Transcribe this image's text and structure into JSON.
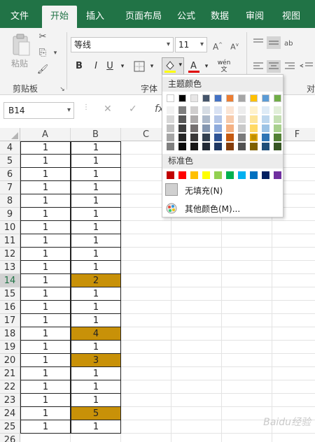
{
  "tabs": [
    {
      "label": "文件",
      "active": false
    },
    {
      "label": "开始",
      "active": true
    },
    {
      "label": "插入",
      "active": false
    },
    {
      "label": "页面布局",
      "active": false
    },
    {
      "label": "公式",
      "active": false
    },
    {
      "label": "数据",
      "active": false
    },
    {
      "label": "审阅",
      "active": false
    },
    {
      "label": "视图",
      "active": false
    }
  ],
  "ribbon": {
    "paste_label": "粘贴",
    "clipboard_group": "剪贴板",
    "font_group": "字体",
    "right_group_partial": "对",
    "font_name": "等线",
    "font_size": "11",
    "bold": "B",
    "italic": "I",
    "underline": "U",
    "phonetic": "wén"
  },
  "formula_bar": {
    "name_box": "B14",
    "fx": "fx"
  },
  "grid": {
    "columns": [
      "A",
      "B",
      "C",
      "F"
    ],
    "rows": [
      {
        "n": "4",
        "a": "1",
        "b": "1",
        "highlight": false
      },
      {
        "n": "5",
        "a": "1",
        "b": "1",
        "highlight": false
      },
      {
        "n": "6",
        "a": "1",
        "b": "1",
        "highlight": false
      },
      {
        "n": "7",
        "a": "1",
        "b": "1",
        "highlight": false
      },
      {
        "n": "8",
        "a": "1",
        "b": "1",
        "highlight": false
      },
      {
        "n": "9",
        "a": "1",
        "b": "1",
        "highlight": false
      },
      {
        "n": "10",
        "a": "1",
        "b": "1",
        "highlight": false
      },
      {
        "n": "11",
        "a": "1",
        "b": "1",
        "highlight": false
      },
      {
        "n": "12",
        "a": "1",
        "b": "1",
        "highlight": false
      },
      {
        "n": "13",
        "a": "1",
        "b": "1",
        "highlight": false
      },
      {
        "n": "14",
        "a": "1",
        "b": "2",
        "highlight": true
      },
      {
        "n": "15",
        "a": "1",
        "b": "1",
        "highlight": false
      },
      {
        "n": "16",
        "a": "1",
        "b": "1",
        "highlight": false
      },
      {
        "n": "17",
        "a": "1",
        "b": "1",
        "highlight": false
      },
      {
        "n": "18",
        "a": "1",
        "b": "4",
        "highlight": true
      },
      {
        "n": "19",
        "a": "1",
        "b": "1",
        "highlight": false
      },
      {
        "n": "20",
        "a": "1",
        "b": "3",
        "highlight": true
      },
      {
        "n": "21",
        "a": "1",
        "b": "1",
        "highlight": false
      },
      {
        "n": "22",
        "a": "1",
        "b": "1",
        "highlight": false
      },
      {
        "n": "23",
        "a": "1",
        "b": "1",
        "highlight": false
      },
      {
        "n": "24",
        "a": "1",
        "b": "5",
        "highlight": true
      },
      {
        "n": "25",
        "a": "1",
        "b": "1",
        "highlight": false
      },
      {
        "n": "26",
        "a": "",
        "b": "",
        "highlight": false
      }
    ],
    "highlight_color": "#C89108",
    "selected_row": "14"
  },
  "color_menu": {
    "theme_header": "主题颜色",
    "standard_header": "标准色",
    "no_fill": "无填充(N)",
    "more_colors": "其他颜色(M)...",
    "theme_top": [
      "#FFFFFF",
      "#000000",
      "#E7E6E6",
      "#44546A",
      "#4472C4",
      "#ED7D31",
      "#A5A5A5",
      "#FFC000",
      "#5B9BD5",
      "#70AD47"
    ],
    "theme_shades": [
      [
        "#F2F2F2",
        "#808080",
        "#D0CECE",
        "#D6DCE4",
        "#D9E2F3",
        "#FBE5D5",
        "#EDEDED",
        "#FFF2CC",
        "#DEEBF6",
        "#E2EFD9"
      ],
      [
        "#D8D8D8",
        "#595959",
        "#AEABAB",
        "#ADB9CA",
        "#B4C6E7",
        "#F7CBAC",
        "#DBDBDB",
        "#FEE599",
        "#BDD7EE",
        "#C5E0B3"
      ],
      [
        "#BFBFBF",
        "#3F3F3F",
        "#757070",
        "#8496B0",
        "#8EAADB",
        "#F4B183",
        "#C9C9C9",
        "#FFD965",
        "#9CC3E5",
        "#A8D08D"
      ],
      [
        "#A5A5A5",
        "#262626",
        "#3A3838",
        "#323F4F",
        "#2F5496",
        "#C55A11",
        "#7B7B7B",
        "#BF9000",
        "#2E75B5",
        "#538135"
      ],
      [
        "#7F7F7F",
        "#0C0C0C",
        "#171616",
        "#222A35",
        "#1F3864",
        "#833C0B",
        "#525252",
        "#7F6000",
        "#1E4E79",
        "#375623"
      ]
    ],
    "standard": [
      "#C00000",
      "#FF0000",
      "#FFC000",
      "#FFFF00",
      "#92D050",
      "#00B050",
      "#00B0F0",
      "#0070C0",
      "#002060",
      "#7030A0"
    ],
    "selected_swatch": "#BF9000"
  },
  "watermark": "Baidu经验"
}
